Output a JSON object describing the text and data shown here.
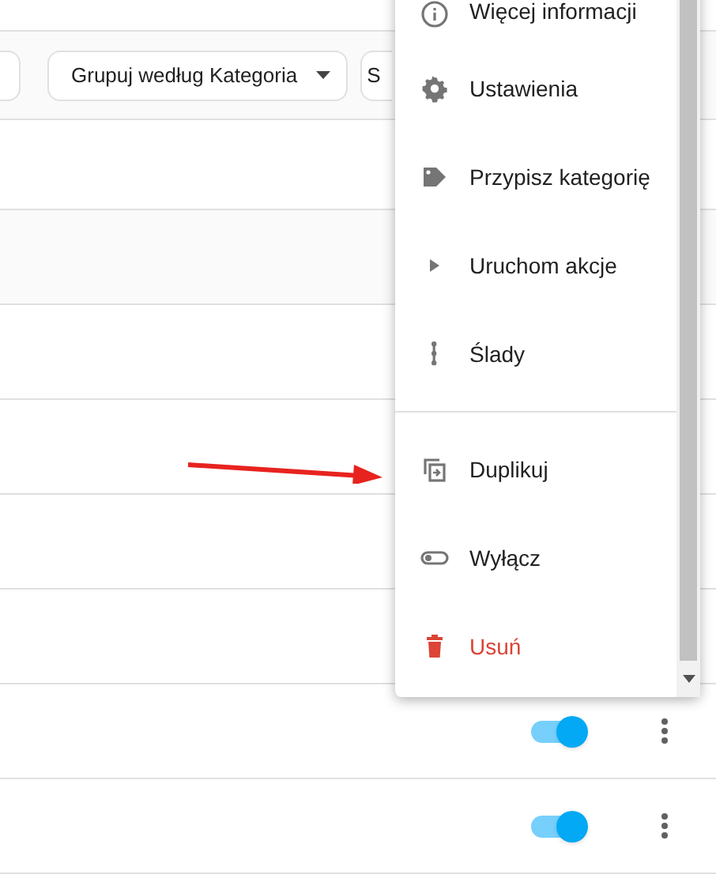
{
  "toolbar": {
    "chips": [
      {
        "label": "Grupuj według Kategoria",
        "dropdown": true
      },
      {
        "label": "S",
        "dropdown": false
      }
    ]
  },
  "rows": [
    {
      "kind": "blank"
    },
    {
      "kind": "group"
    },
    {
      "kind": "blank"
    },
    {
      "kind": "blank"
    },
    {
      "kind": "blank"
    },
    {
      "kind": "blank"
    },
    {
      "kind": "switch",
      "on": true
    },
    {
      "kind": "switch",
      "on": true
    }
  ],
  "menu": {
    "sections": [
      [
        {
          "kind": "info",
          "label": "Więcej informacji",
          "danger": false
        },
        {
          "kind": "gear",
          "label": "Ustawienia",
          "danger": false
        },
        {
          "kind": "tag",
          "label": "Przypisz kategorię",
          "danger": false
        },
        {
          "kind": "play",
          "label": "Uruchom akcje",
          "danger": false
        },
        {
          "kind": "trace",
          "label": "Ślady",
          "danger": false
        }
      ],
      [
        {
          "kind": "copy",
          "label": "Duplikuj",
          "danger": false
        },
        {
          "kind": "toggle",
          "label": "Wyłącz",
          "danger": false
        },
        {
          "kind": "trash",
          "label": "Usuń",
          "danger": true
        }
      ]
    ]
  }
}
